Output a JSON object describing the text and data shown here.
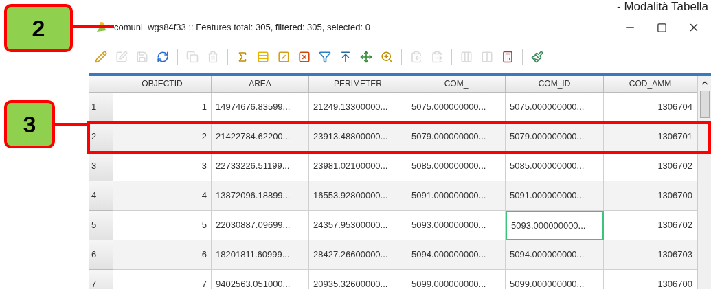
{
  "heading": "- Modalità Tabella",
  "callouts": [
    {
      "label": "2"
    },
    {
      "label": "3"
    }
  ],
  "window": {
    "title": "comuni_wgs84f33 :: Features total: 305, filtered: 305, selected: 0"
  },
  "toolbar": [
    [
      {
        "disabled": false
      },
      {
        "disabled": true
      },
      {
        "disabled": true
      },
      {
        "disabled": false
      }
    ],
    [
      {
        "disabled": true
      },
      {
        "disabled": true
      }
    ],
    [
      {
        "disabled": false
      },
      {
        "disabled": false
      },
      {
        "disabled": false
      },
      {
        "disabled": false
      },
      {
        "disabled": false
      },
      {
        "disabled": false
      },
      {
        "disabled": false
      },
      {
        "disabled": false
      }
    ],
    [
      {
        "disabled": true
      },
      {
        "disabled": true
      }
    ],
    [
      {
        "disabled": true
      },
      {
        "disabled": true
      },
      {
        "disabled": false
      }
    ],
    [
      {
        "disabled": false
      }
    ]
  ],
  "table": {
    "columns": [
      "OBJECTID",
      "AREA",
      "PERIMETER",
      "COM_",
      "COM_ID",
      "COD_AMM"
    ],
    "rows": [
      {
        "header": "1",
        "highlighted": false,
        "cells": [
          {
            "text": "1",
            "focused": false
          },
          {
            "text": "14974676.83599...",
            "focused": false
          },
          {
            "text": "21249.13300000...",
            "focused": false
          },
          {
            "text": "5075.000000000...",
            "focused": false
          },
          {
            "text": "5075.000000000...",
            "focused": false
          },
          {
            "text": "1306704",
            "focused": false
          }
        ]
      },
      {
        "header": "2",
        "highlighted": true,
        "cells": [
          {
            "text": "2",
            "focused": false
          },
          {
            "text": "21422784.62200...",
            "focused": false
          },
          {
            "text": "23913.48800000...",
            "focused": false
          },
          {
            "text": "5079.000000000...",
            "focused": false
          },
          {
            "text": "5079.000000000...",
            "focused": false
          },
          {
            "text": "1306701",
            "focused": false
          }
        ]
      },
      {
        "header": "3",
        "highlighted": false,
        "cells": [
          {
            "text": "3",
            "focused": false
          },
          {
            "text": "22733226.51199...",
            "focused": false
          },
          {
            "text": "23981.02100000...",
            "focused": false
          },
          {
            "text": "5085.000000000...",
            "focused": false
          },
          {
            "text": "5085.000000000...",
            "focused": false
          },
          {
            "text": "1306702",
            "focused": false
          }
        ]
      },
      {
        "header": "4",
        "highlighted": false,
        "cells": [
          {
            "text": "4",
            "focused": false
          },
          {
            "text": "13872096.18899...",
            "focused": false
          },
          {
            "text": "16553.92800000...",
            "focused": false
          },
          {
            "text": "5091.000000000...",
            "focused": false
          },
          {
            "text": "5091.000000000...",
            "focused": false
          },
          {
            "text": "1306700",
            "focused": false
          }
        ]
      },
      {
        "header": "5",
        "highlighted": false,
        "cells": [
          {
            "text": "5",
            "focused": false
          },
          {
            "text": "22030887.09699...",
            "focused": false
          },
          {
            "text": "24357.95300000...",
            "focused": false
          },
          {
            "text": "5093.000000000...",
            "focused": false
          },
          {
            "text": "5093.000000000...",
            "focused": true
          },
          {
            "text": "1306702",
            "focused": false
          }
        ]
      },
      {
        "header": "6",
        "highlighted": false,
        "cells": [
          {
            "text": "6",
            "focused": false
          },
          {
            "text": "18201811.60999...",
            "focused": false
          },
          {
            "text": "28427.26600000...",
            "focused": false
          },
          {
            "text": "5094.000000000...",
            "focused": false
          },
          {
            "text": "5094.000000000...",
            "focused": false
          },
          {
            "text": "1306703",
            "focused": false
          }
        ]
      },
      {
        "header": "7",
        "highlighted": false,
        "cells": [
          {
            "text": "7",
            "focused": false
          },
          {
            "text": "9402563.051000...",
            "focused": false
          },
          {
            "text": "20935.32600000...",
            "focused": false
          },
          {
            "text": "5099.000000000...",
            "focused": false
          },
          {
            "text": "5099.000000000...",
            "focused": false
          },
          {
            "text": "1306700",
            "focused": false
          }
        ]
      }
    ]
  }
}
